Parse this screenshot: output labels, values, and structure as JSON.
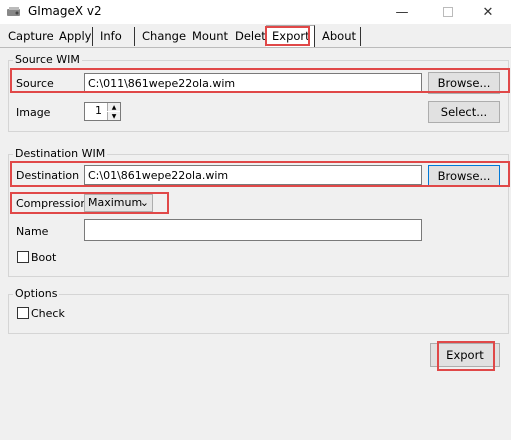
{
  "window": {
    "title": "GImageX v2"
  },
  "tabs": [
    "Capture",
    "Apply",
    "Info",
    "Change",
    "Mount",
    "Delete",
    "Export",
    "About"
  ],
  "source_group": {
    "title": "Source WIM",
    "source_label": "Source",
    "source_value": "C:\\011\\861wepe22ola.wim",
    "browse_label": "Browse...",
    "image_label": "Image",
    "image_value": "1",
    "select_label": "Select..."
  },
  "destination_group": {
    "title": "Destination WIM",
    "destination_label": "Destination",
    "destination_value": "C:\\01\\861wepe22ola.wim",
    "browse_label": "Browse...",
    "compression_label": "Compression",
    "compression_value": "Maximum",
    "name_label": "Name",
    "name_value": "",
    "boot_label": "Boot"
  },
  "options_group": {
    "title": "Options",
    "check_label": "Check"
  },
  "export_label": "Export",
  "colors": {
    "highlight": "#e04848",
    "focus": "#0078d7"
  }
}
